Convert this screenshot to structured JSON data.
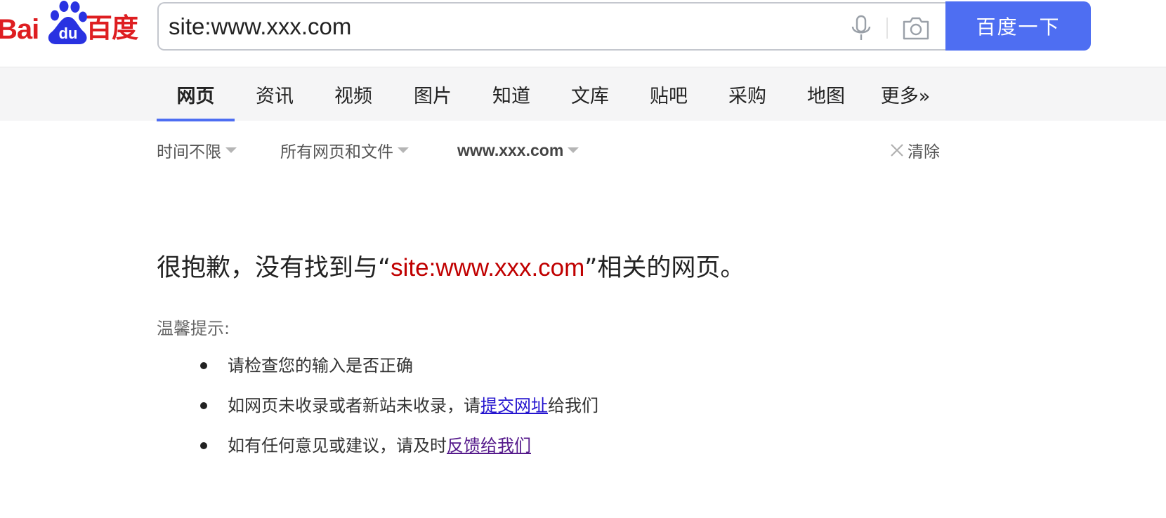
{
  "header": {
    "logo": {
      "text_left": "Bai",
      "text_paw": "du",
      "text_right": "百度",
      "color": "#de1e21"
    },
    "search": {
      "value": "site:www.xxx.com",
      "button_label": "百度一下",
      "button_color": "#4e6ef2"
    }
  },
  "tabs": [
    {
      "label": "网页",
      "active": true
    },
    {
      "label": "资讯",
      "active": false
    },
    {
      "label": "视频",
      "active": false
    },
    {
      "label": "图片",
      "active": false
    },
    {
      "label": "知道",
      "active": false
    },
    {
      "label": "文库",
      "active": false
    },
    {
      "label": "贴吧",
      "active": false
    },
    {
      "label": "采购",
      "active": false
    },
    {
      "label": "地图",
      "active": false
    },
    {
      "label": "更多»",
      "active": false
    }
  ],
  "filters": {
    "time": "时间不限",
    "type": "所有网页和文件",
    "site": "www.xxx.com",
    "clear": "清除"
  },
  "result": {
    "prefix": "很抱歉，没有找到与“",
    "query": "site:www.xxx.com",
    "suffix": "”相关的网页。",
    "query_color": "#c00000"
  },
  "tips": {
    "title": "温馨提示:",
    "items": [
      {
        "text": "请检查您的输入是否正确",
        "link": "",
        "after": ""
      },
      {
        "text": "如网页未收录或者新站未收录，请",
        "link": "提交网址",
        "after": "给我们"
      },
      {
        "text": "如有任何意见或建议，请及时",
        "link": "反馈给我们",
        "after": ""
      }
    ]
  }
}
